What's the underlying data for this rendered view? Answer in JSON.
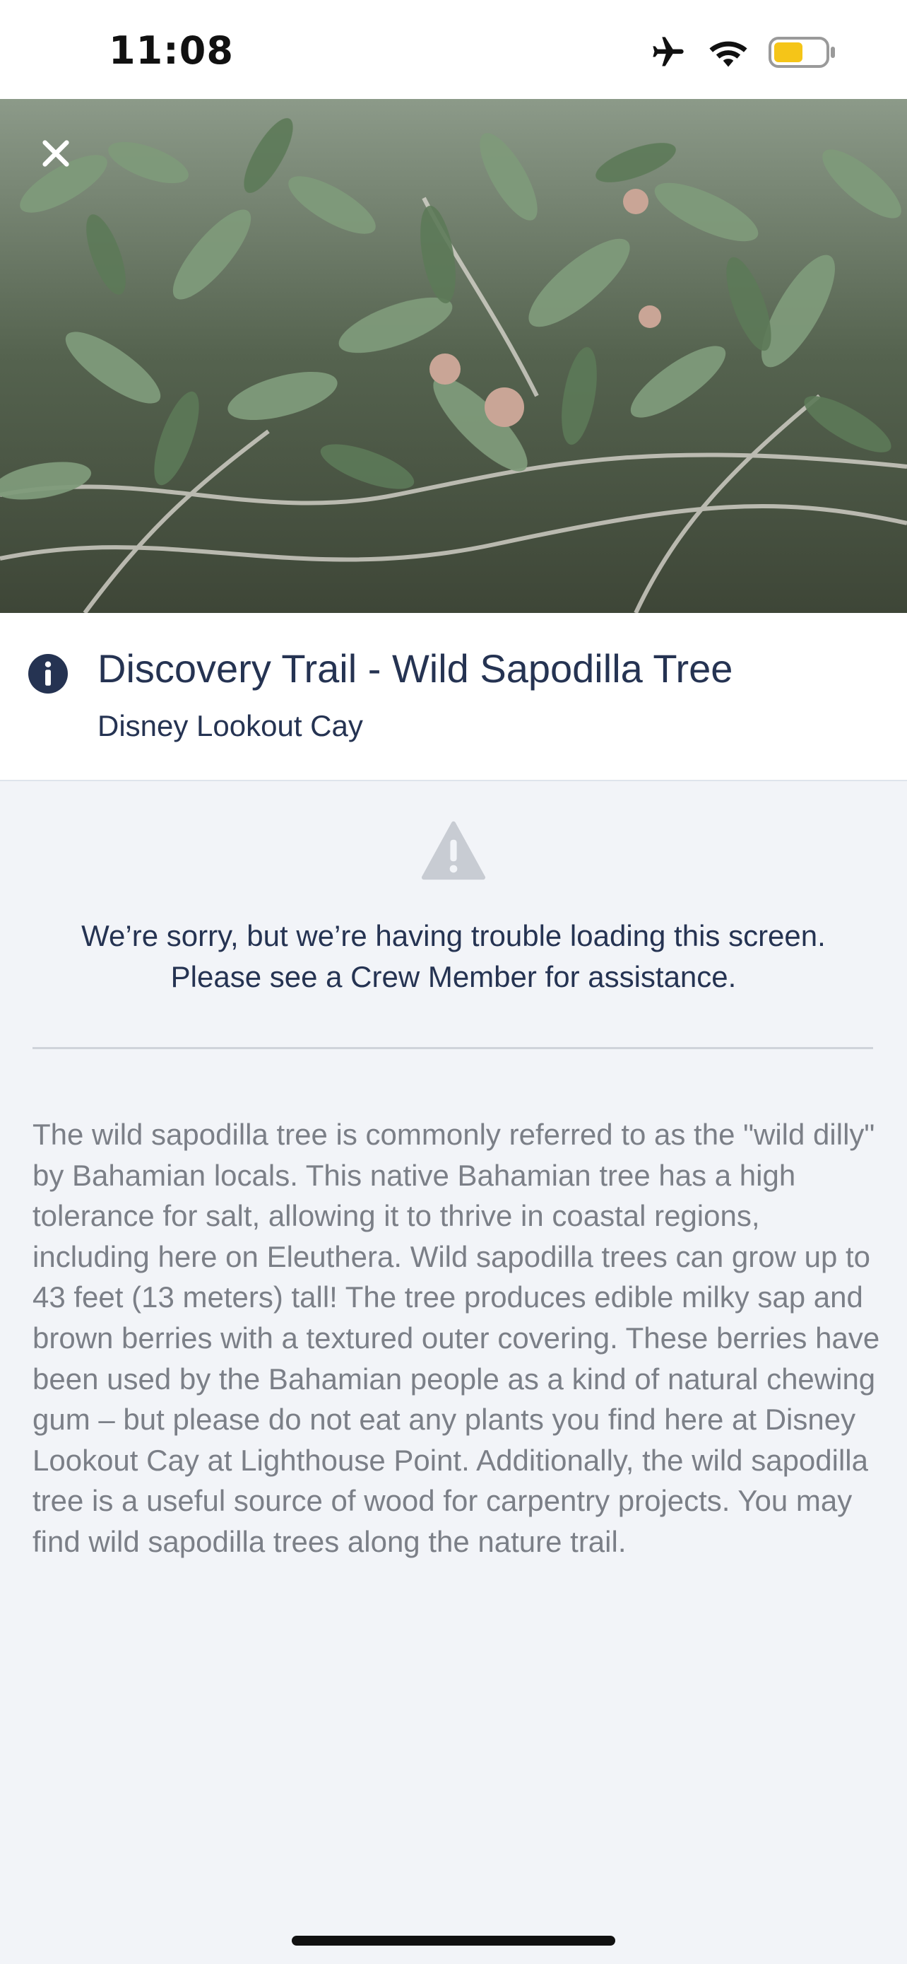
{
  "status_bar": {
    "time": "11:08",
    "icons": [
      "airplane-icon",
      "wifi-icon",
      "battery-icon"
    ],
    "battery_color": "#f5c518"
  },
  "hero": {
    "image_subject": "wild-sapodilla-tree-photo",
    "close_icon": "close-icon"
  },
  "header": {
    "title": "Discovery Trail - Wild Sapodilla Tree",
    "subtitle": "Disney Lookout Cay",
    "icon": "info-icon"
  },
  "error": {
    "icon": "warning-icon",
    "message": "We’re sorry, but we’re having trouble loading this screen. Please see a Crew Member for assistance."
  },
  "description": "The wild sapodilla tree is commonly referred to as the \"wild dilly\" by Bahamian locals. This native Bahamian tree has a high tolerance for salt, allowing it to thrive in coastal regions, including here on Eleuthera. Wild sapodilla trees can grow up to 43 feet (13 meters) tall! The tree produces edible milky sap and brown berries with a textured outer covering. These berries have been used by the Bahamian people as a kind of natural chewing gum – but please do not eat any plants you find here at Disney Lookout Cay at Lighthouse Point. Additionally, the wild sapodilla tree is a useful source of wood for carpentry projects. You may find wild sapodilla trees along the nature trail.",
  "colors": {
    "title": "#253352",
    "body_text": "#7b7f87",
    "background": "#f2f4f8"
  }
}
